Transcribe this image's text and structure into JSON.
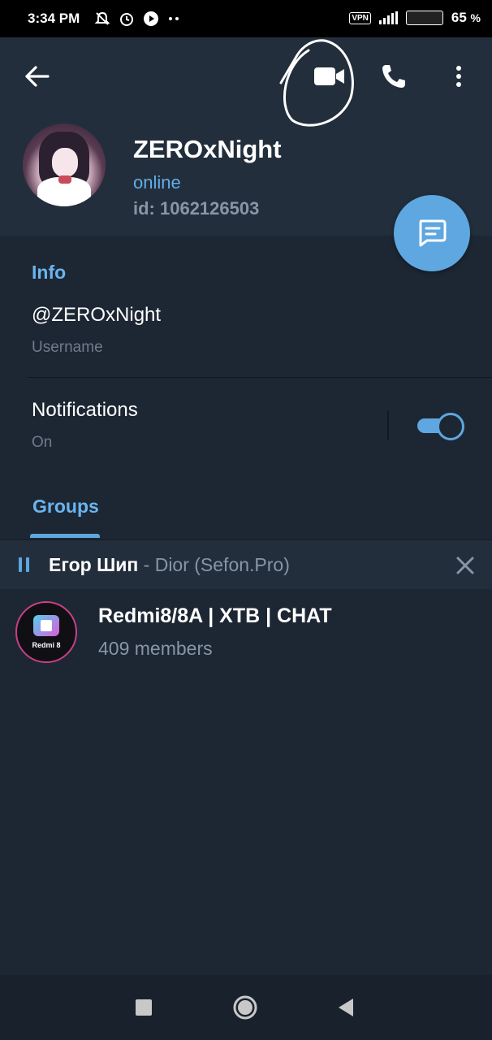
{
  "status_bar": {
    "time": "3:34 PM",
    "vpn": "VPN",
    "battery_percent": "65",
    "percent_sign": "%"
  },
  "toolbar": {
    "back_icon": "arrow-left-icon",
    "video_icon": "video-camera-icon",
    "phone_icon": "phone-icon",
    "more_icon": "more-vertical-icon"
  },
  "profile": {
    "name": "ZEROxNight",
    "status": "online",
    "id_text": "id: 1062126503"
  },
  "info": {
    "title": "Info",
    "username_value": "@ZEROxNight",
    "username_label": "Username",
    "notifications_value": "Notifications",
    "notifications_label": "On",
    "notifications_enabled": true
  },
  "tabs": {
    "groups_label": "Groups"
  },
  "player": {
    "artist": "Егор Шип",
    "separator": " - ",
    "track": "Dior (Sefon.Pro)"
  },
  "groups": [
    {
      "name": "Redmi8/8A | XTB | CHAT",
      "members": "409 members",
      "avatar_text": "Redmi 8"
    }
  ],
  "colors": {
    "accent": "#5ea7e0",
    "background": "#1d2733",
    "header": "#232e3c"
  }
}
